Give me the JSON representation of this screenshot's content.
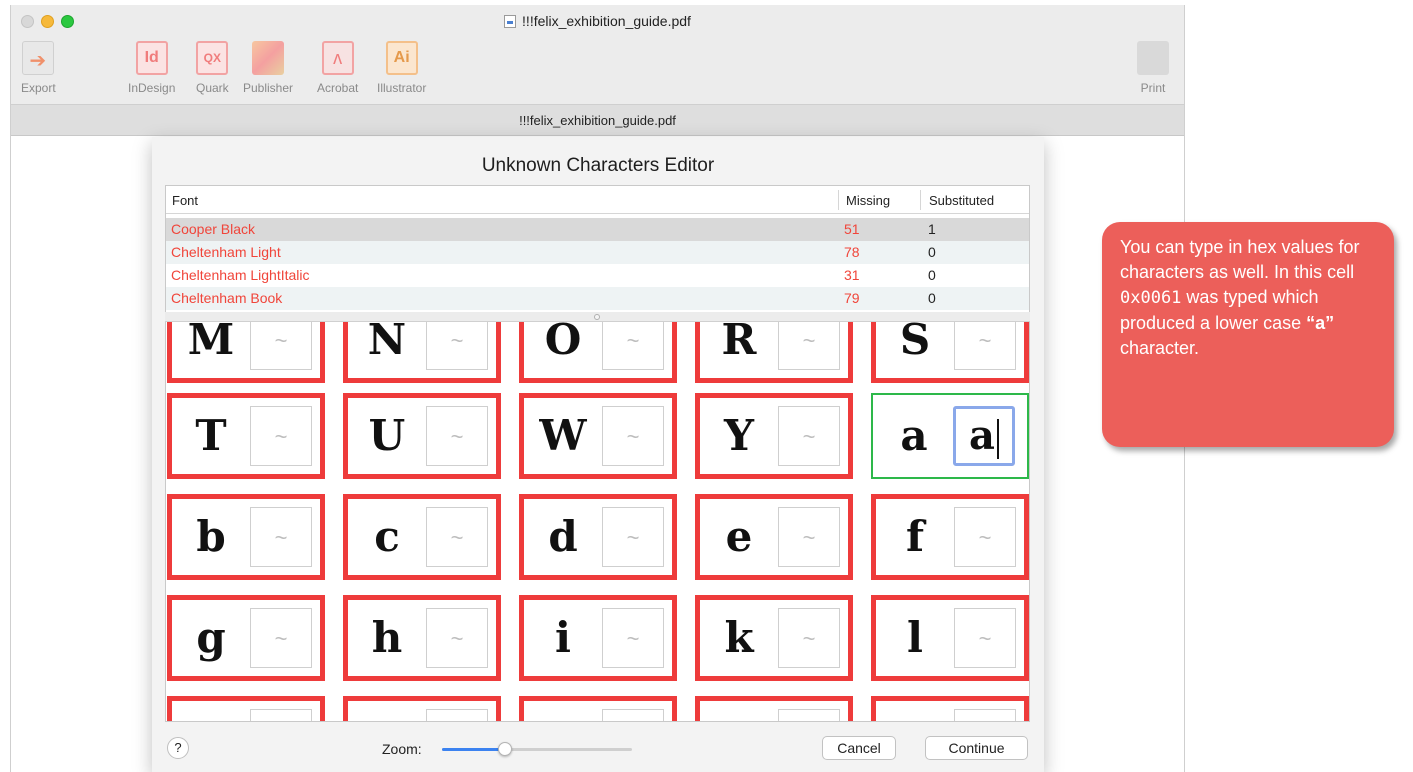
{
  "window": {
    "title": "!!!felix_exhibition_guide.pdf",
    "doc_title": "!!!felix_exhibition_guide.pdf"
  },
  "toolbar": {
    "export_label": "Export",
    "indesign_label": "InDesign",
    "quark_label": "Quark",
    "publisher_label": "Publisher",
    "acrobat_label": "Acrobat",
    "illustrator_label": "Illustrator",
    "print_label": "Print",
    "indesign_glyph": "Id",
    "quark_glyph": "QX",
    "acrobat_glyph": "ᴧ",
    "illustrator_glyph": "Ai"
  },
  "dialog": {
    "title": "Unknown Characters Editor",
    "columns": {
      "font": "Font",
      "missing": "Missing",
      "substituted": "Substituted"
    },
    "fonts": [
      {
        "name": "Cooper Black",
        "missing": "51",
        "substituted": "1"
      },
      {
        "name": "Cheltenham Light",
        "missing": "78",
        "substituted": "0"
      },
      {
        "name": "Cheltenham LightItalic",
        "missing": "31",
        "substituted": "0"
      },
      {
        "name": "Cheltenham Book",
        "missing": "79",
        "substituted": "0"
      }
    ],
    "placeholder": "~",
    "cells_row0": [
      "M",
      "N",
      "O",
      "R",
      "S"
    ],
    "cells_row1": [
      "T",
      "U",
      "W",
      "Y",
      "a"
    ],
    "cells_row2": [
      "b",
      "c",
      "d",
      "e",
      "f"
    ],
    "cells_row3": [
      "g",
      "h",
      "i",
      "k",
      "l"
    ],
    "active_substitution": "a",
    "help_label": "?",
    "zoom_label": "Zoom:",
    "zoom_level": 0.33,
    "cancel_label": "Cancel",
    "continue_label": "Continue"
  },
  "callout": {
    "text_1": "You can type in hex values for characters as well. In this cell ",
    "hex": "0x0061",
    "text_2": " was typed which produced a lower case ",
    "char": "“a”",
    "text_3": " character.",
    "color": "#ec5f5a"
  },
  "colors": {
    "missing_red": "#ee3b3b",
    "ok_green": "#2db84a",
    "focus_blue": "#8aa8ea",
    "slider_blue": "#3b82f0"
  }
}
